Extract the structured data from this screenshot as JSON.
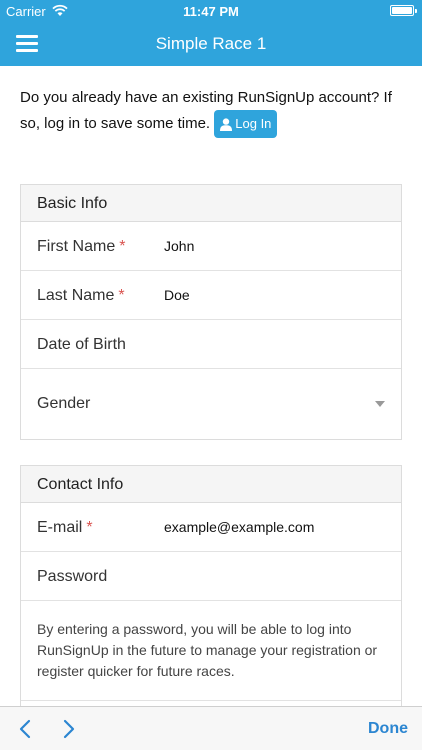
{
  "status_bar": {
    "carrier": "Carrier",
    "time": "11:47 PM"
  },
  "nav": {
    "title": "Simple Race 1"
  },
  "intro": {
    "text": "Do you already have an existing RunSignUp account? If so, log in to save some time.",
    "login_label": "Log In"
  },
  "basic_info": {
    "title": "Basic Info",
    "first_name": {
      "label": "First Name",
      "required": "*",
      "value": "John"
    },
    "last_name": {
      "label": "Last Name",
      "required": "*",
      "value": "Doe"
    },
    "dob": {
      "label": "Date of Birth"
    },
    "gender": {
      "label": "Gender"
    }
  },
  "contact_info": {
    "title": "Contact Info",
    "email": {
      "label": "E-mail",
      "required": "*",
      "value": "example@example.com"
    },
    "password": {
      "label": "Password"
    },
    "help": "By entering a password, you will be able to log into RunSignUp in the future to manage your registration or register quicker for future races."
  },
  "toolbar": {
    "done_label": "Done"
  },
  "colors": {
    "accent": "#2fa4dc",
    "required": "#d9534f",
    "done": "#2c86d1"
  },
  "icons": [
    "wifi-icon",
    "battery-icon",
    "menu-icon",
    "user-icon",
    "chevron-down-icon",
    "back-arrow-icon",
    "forward-arrow-icon"
  ]
}
